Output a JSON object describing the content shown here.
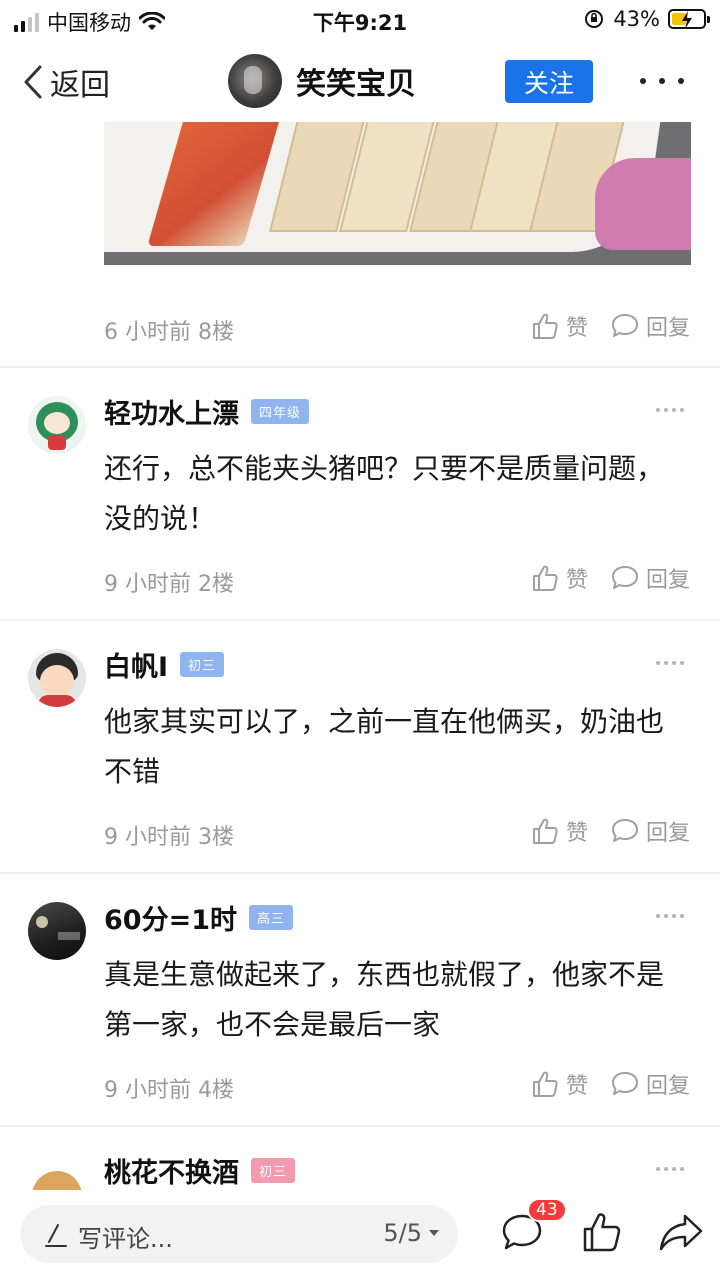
{
  "status_bar": {
    "carrier": "中国移动",
    "time": "下午9:21",
    "battery": "43%"
  },
  "nav": {
    "back_label": "返回",
    "title": "笑笑宝贝",
    "follow_label": "关注"
  },
  "first_post": {
    "meta": "6 小时前 8楼",
    "like_label": "赞",
    "reply_label": "回复"
  },
  "comments": [
    {
      "name": "轻功水上漂",
      "badge": "四年级",
      "badge_color": "#8fb4ef",
      "text": "还行，总不能夹头猪吧？只要不是质量问题，没的说！",
      "meta": "9 小时前 2楼",
      "like_label": "赞",
      "reply_label": "回复"
    },
    {
      "name": "白帆I",
      "badge": "初三",
      "badge_color": "#8fb4ef",
      "text": "他家其实可以了，之前一直在他俩买，奶油也不错",
      "meta": "9 小时前 3楼",
      "like_label": "赞",
      "reply_label": "回复"
    },
    {
      "name": "60分=1时",
      "badge": "高三",
      "badge_color": "#8fb4ef",
      "text": "真是生意做起来了，东西也就假了，他家不是第一家，也不会是最后一家",
      "meta": "9 小时前 4楼",
      "like_label": "赞",
      "reply_label": "回复"
    },
    {
      "name": "桃花不换酒",
      "badge": "初三",
      "badge_color": "#f29aae"
    }
  ],
  "bottom_bar": {
    "placeholder": "写评论...",
    "page_indicator": "5/5",
    "comment_count": "43"
  }
}
